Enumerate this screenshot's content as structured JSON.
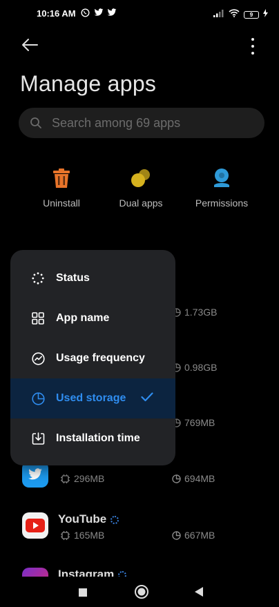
{
  "status_bar": {
    "time": "10:16 AM",
    "battery": "9"
  },
  "header": {
    "title": "Manage apps"
  },
  "search": {
    "placeholder": "Search among 69 apps"
  },
  "quick_actions": [
    {
      "label": "Uninstall",
      "icon": "trash-icon",
      "color": "#e8742a"
    },
    {
      "label": "Dual apps",
      "icon": "dual-circles-icon",
      "color": "#d6b21e"
    },
    {
      "label": "Permissions",
      "icon": "permission-icon",
      "color": "#2e9ad8"
    }
  ],
  "apps": [
    {
      "name": "",
      "app_size": "",
      "storage": "1.73GB"
    },
    {
      "name": "",
      "app_size": "",
      "storage": "0.98GB"
    },
    {
      "name": "",
      "app_size": "",
      "storage": "769MB"
    },
    {
      "name": "Twitter",
      "app_size": "296MB",
      "storage": "694MB"
    },
    {
      "name": "YouTube",
      "app_size": "165MB",
      "storage": "667MB"
    },
    {
      "name": "Instagram",
      "app_size": "",
      "storage": ""
    }
  ],
  "sort_menu": {
    "items": [
      {
        "label": "Status",
        "icon": "status-icon",
        "selected": false
      },
      {
        "label": "App name",
        "icon": "grid-icon",
        "selected": false
      },
      {
        "label": "Usage frequency",
        "icon": "trend-icon",
        "selected": false
      },
      {
        "label": "Used storage",
        "icon": "pie-icon",
        "selected": true
      },
      {
        "label": "Installation time",
        "icon": "download-box-icon",
        "selected": false
      }
    ],
    "accent": "#2f8df0"
  }
}
